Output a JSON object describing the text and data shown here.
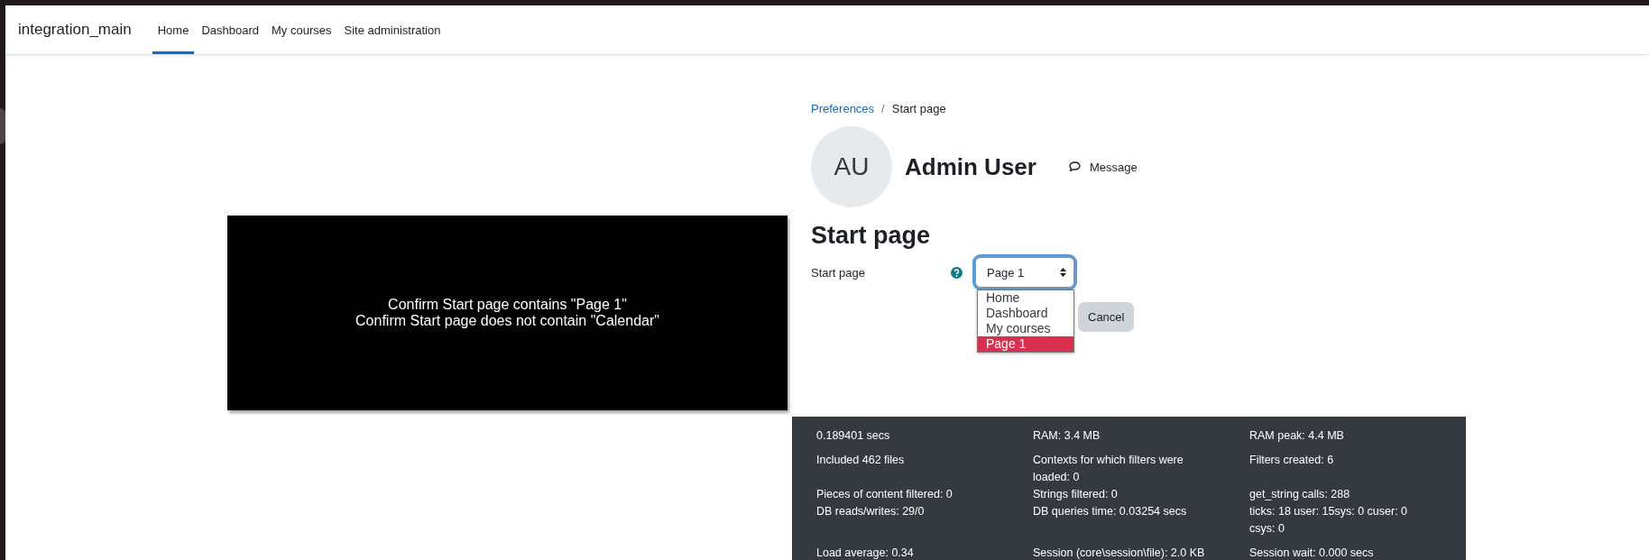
{
  "navbar": {
    "brand": "integration_main",
    "items": [
      {
        "label": "Home",
        "selected": true
      },
      {
        "label": "Dashboard",
        "selected": false
      },
      {
        "label": "My courses",
        "selected": false
      },
      {
        "label": "Site administration",
        "selected": false
      }
    ]
  },
  "overlay": {
    "lines": [
      "Confirm Start page contains \"Page 1\"",
      "Confirm Start page does not contain \"Calendar\""
    ]
  },
  "breadcrumb_separator": "/",
  "breadcrumb": [
    {
      "label": "Preferences",
      "kind": "link"
    },
    {
      "label": "Start page",
      "kind": "current"
    }
  ],
  "profile": {
    "initials": "AU",
    "name": "Admin User",
    "message": "Message"
  },
  "heading": "Start page",
  "form": {
    "label": "Start page",
    "select": {
      "value": "Page 1",
      "expanded": true,
      "options": [
        {
          "label": "Home",
          "selected": false
        },
        {
          "label": "Dashboard",
          "selected": false
        },
        {
          "label": "My courses",
          "selected": false
        },
        {
          "label": "Page 1",
          "selected": true
        }
      ]
    },
    "cancel": "Cancel"
  },
  "footer": {
    "groups": [
      {
        "rows": [
          [
            "0.189401 secs",
            "RAM: 3.4 MB",
            "RAM peak: 4.4 MB"
          ]
        ]
      },
      {
        "rows": [
          [
            "Included 462 files",
            "Contexts for which filters were loaded: 0",
            "Filters created: 6"
          ],
          [
            "Pieces of content filtered: 0",
            "Strings filtered: 0",
            "get_string calls: 288"
          ],
          [
            "DB reads/writes: 29/0",
            "DB queries time: 0.03254 secs",
            "ticks: 18 user: 15sys: 0 cuser: 0 csys: 0"
          ]
        ]
      },
      {
        "rows": [
          [
            "Load average: 0.34",
            "Session (core\\session\\file): 2.0 KB",
            "Session wait: 0.000 secs"
          ]
        ]
      }
    ]
  }
}
